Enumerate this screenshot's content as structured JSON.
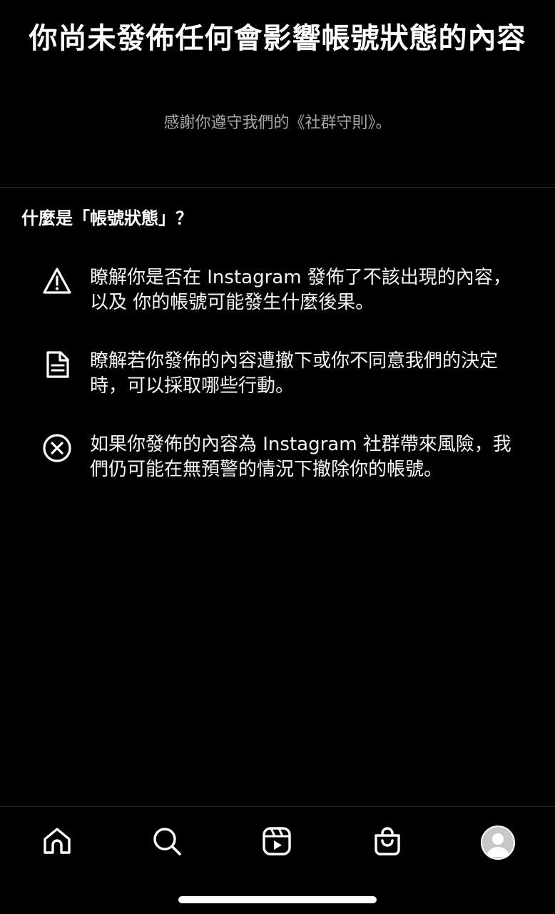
{
  "header": {
    "title": "你尚未發佈任何會影響帳號狀態的內容",
    "subtitle": "感謝你遵守我們的《社群守則》。"
  },
  "section": {
    "heading": "什麼是「帳號狀態」？",
    "items": [
      {
        "icon": "warning-triangle-icon",
        "text": "瞭解你是否在 Instagram 發佈了不該出現的內容，以及 你的帳號可能發生什麼後果。"
      },
      {
        "icon": "document-icon",
        "text": "瞭解若你發佈的內容遭撤下或你不同意我們的決定時，可以採取哪些行動。"
      },
      {
        "icon": "close-circle-icon",
        "text": "如果你發佈的內容為 Instagram 社群帶來風險，我們仍可能在無預警的情況下撤除你的帳號。"
      }
    ]
  },
  "tabbar": {
    "tabs": [
      "home-icon",
      "search-icon",
      "reels-icon",
      "shop-icon",
      "profile-avatar"
    ]
  },
  "colors": {
    "background": "#000000",
    "text_primary": "#ffffff",
    "text_secondary": "#a8a8a8",
    "divider": "#262626"
  }
}
